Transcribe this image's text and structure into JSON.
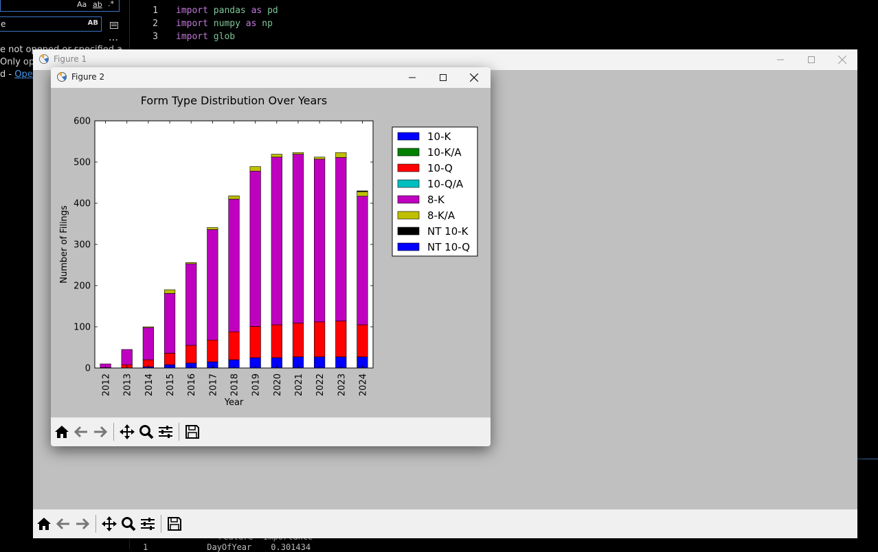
{
  "editor": {
    "find": {
      "case_label": "Aa",
      "word_label": "ab",
      "regex_label": ".*",
      "input_value": "e",
      "preserve_case_label": "AB",
      "more_label": "…"
    },
    "messages": {
      "line1": "e not opened or specified a",
      "line2": "Only ope",
      "line3_prefix": "d - ",
      "line3_link": "Open"
    },
    "code": [
      {
        "n": "1",
        "kw": "import",
        "mod": "pandas",
        "as": "as",
        "alias": "pd"
      },
      {
        "n": "2",
        "kw": "import",
        "mod": "numpy",
        "as": "as",
        "alias": "np"
      },
      {
        "n": "3",
        "kw": "import",
        "mod": "glob",
        "as": "",
        "alias": ""
      }
    ],
    "bottom_header": "Feature  Importance",
    "bottom_row": {
      "n": "1",
      "feature": "DayOfYear",
      "value": "0.301434"
    }
  },
  "figure1": {
    "title": "Figure 1"
  },
  "figure2": {
    "title": "Figure 2"
  },
  "toolbar_icons": [
    "home-icon",
    "back-arrow-icon",
    "forward-arrow-icon",
    "pan-icon",
    "zoom-icon",
    "configure-subplots-icon",
    "save-icon"
  ],
  "colors": {
    "10-K": "#0000ff",
    "10-K/A": "#008000",
    "10-Q": "#ff0000",
    "10-Q/A": "#00bfbf",
    "8-K": "#bf00bf",
    "8-K/A": "#bfbf00",
    "NT 10-K": "#000000",
    "NT 10-Q": "#0000ff"
  },
  "chart_data": {
    "type": "bar",
    "stacked": true,
    "title": "Form Type Distribution Over Years",
    "xlabel": "Year",
    "ylabel": "Number of Filings",
    "ylim": [
      0,
      600
    ],
    "yticks": [
      0,
      100,
      200,
      300,
      400,
      500,
      600
    ],
    "legend_position": "right",
    "grid": false,
    "categories": [
      "2012",
      "2013",
      "2014",
      "2015",
      "2016",
      "2017",
      "2018",
      "2019",
      "2020",
      "2021",
      "2022",
      "2023",
      "2024"
    ],
    "series": [
      {
        "name": "10-K",
        "values": [
          0,
          0,
          3,
          8,
          12,
          15,
          20,
          25,
          25,
          27,
          27,
          27,
          27
        ]
      },
      {
        "name": "10-K/A",
        "values": [
          0,
          0,
          0,
          0,
          0,
          0,
          0,
          0,
          0,
          0,
          0,
          0,
          0
        ]
      },
      {
        "name": "10-Q",
        "values": [
          1,
          8,
          17,
          28,
          43,
          53,
          68,
          76,
          80,
          82,
          85,
          87,
          78
        ]
      },
      {
        "name": "10-Q/A",
        "values": [
          0,
          0,
          0,
          0,
          0,
          0,
          0,
          0,
          0,
          0,
          0,
          0,
          0
        ]
      },
      {
        "name": "8-K",
        "values": [
          9,
          37,
          78,
          145,
          198,
          268,
          322,
          377,
          407,
          410,
          395,
          397,
          312
        ]
      },
      {
        "name": "8-K/A",
        "values": [
          0,
          0,
          2,
          9,
          3,
          5,
          8,
          11,
          7,
          4,
          5,
          12,
          11
        ]
      },
      {
        "name": "NT 10-K",
        "values": [
          0,
          0,
          0,
          0,
          0,
          0,
          0,
          0,
          0,
          0,
          0,
          0,
          2
        ]
      },
      {
        "name": "NT 10-Q",
        "values": [
          0,
          0,
          0,
          0,
          0,
          0,
          0,
          0,
          0,
          0,
          0,
          0,
          0
        ]
      }
    ]
  }
}
